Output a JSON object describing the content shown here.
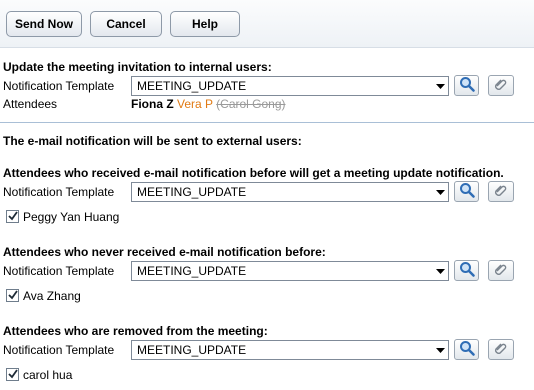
{
  "toolbar": {
    "send_now": "Send Now",
    "cancel": "Cancel",
    "help": "Help"
  },
  "internal": {
    "heading": "Update the meeting invitation to internal users:",
    "template_label": "Notification Template",
    "template_value": "MEETING_UPDATE",
    "attendees_label": "Attendees",
    "attendees": [
      {
        "name": "Fiona Z",
        "status": "existing"
      },
      {
        "name": "Vera P",
        "status": "added"
      },
      {
        "name": "(Carol Gong)",
        "status": "removed"
      }
    ]
  },
  "external_heading": "The e-mail notification will be sent to external users:",
  "groups": [
    {
      "heading": "Attendees who received e-mail notification before will get a meeting update notification.",
      "template_label": "Notification Template",
      "template_value": "MEETING_UPDATE",
      "person": "Peggy Yan Huang",
      "checked": true
    },
    {
      "heading": "Attendees who never received e-mail notification before:",
      "template_label": "Notification Template",
      "template_value": "MEETING_UPDATE",
      "person": "Ava Zhang",
      "checked": true
    },
    {
      "heading": "Attendees who are removed from the meeting:",
      "template_label": "Notification Template",
      "template_value": "MEETING_UPDATE",
      "person": "carol hua",
      "checked": true
    }
  ],
  "colors": {
    "added_attendee": "#e07a14",
    "removed_attendee": "#9a9a9a",
    "divider": "#a9bfd6",
    "search_icon": "#2f6db5"
  },
  "icons": {
    "search": "magnifier-icon",
    "attach": "paperclip-icon",
    "dropdown": "triangle-down-icon",
    "check": "checkmark-icon"
  }
}
